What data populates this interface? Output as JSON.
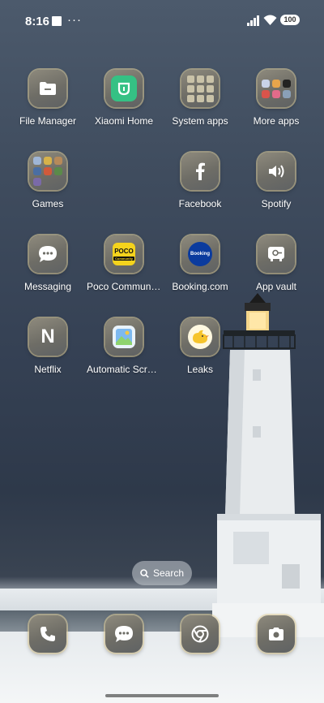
{
  "status_bar": {
    "time": "8:16",
    "dots": "···",
    "battery": "100"
  },
  "apps": [
    {
      "label": "File Manager",
      "icon": "folder-icon"
    },
    {
      "label": "Xiaomi Home",
      "icon": "mi-home-icon"
    },
    {
      "label": "System apps",
      "icon": "folder-icon"
    },
    {
      "label": "More apps",
      "icon": "folder-icon"
    },
    {
      "label": "Games",
      "icon": "folder-icon"
    },
    {
      "label": "Facebook",
      "icon": "facebook-icon"
    },
    {
      "label": "Spotify",
      "icon": "speaker-icon"
    },
    {
      "label": "Messaging",
      "icon": "chat-bubble-icon"
    },
    {
      "label": "Poco Communi…",
      "icon": "poco-icon",
      "logo_text": "POCO",
      "logo_subtext": "Community"
    },
    {
      "label": "Booking.com",
      "icon": "booking-icon",
      "logo_text": "Booking"
    },
    {
      "label": "App vault",
      "icon": "vault-icon"
    },
    {
      "label": "Netflix",
      "icon": "netflix-icon",
      "logo_text": "N"
    },
    {
      "label": "Automatic Scre…",
      "icon": "picture-frame-icon"
    },
    {
      "label": "Leaks",
      "icon": "bird-icon"
    }
  ],
  "search": {
    "label": "Search"
  },
  "dock": [
    {
      "icon": "phone-icon"
    },
    {
      "icon": "messages-icon"
    },
    {
      "icon": "chrome-icon"
    },
    {
      "icon": "camera-icon"
    }
  ],
  "colors": {
    "tile_glow": "#e8d6a0",
    "poco_yellow": "#f5d31c",
    "booking_blue": "#0b3b9e"
  }
}
